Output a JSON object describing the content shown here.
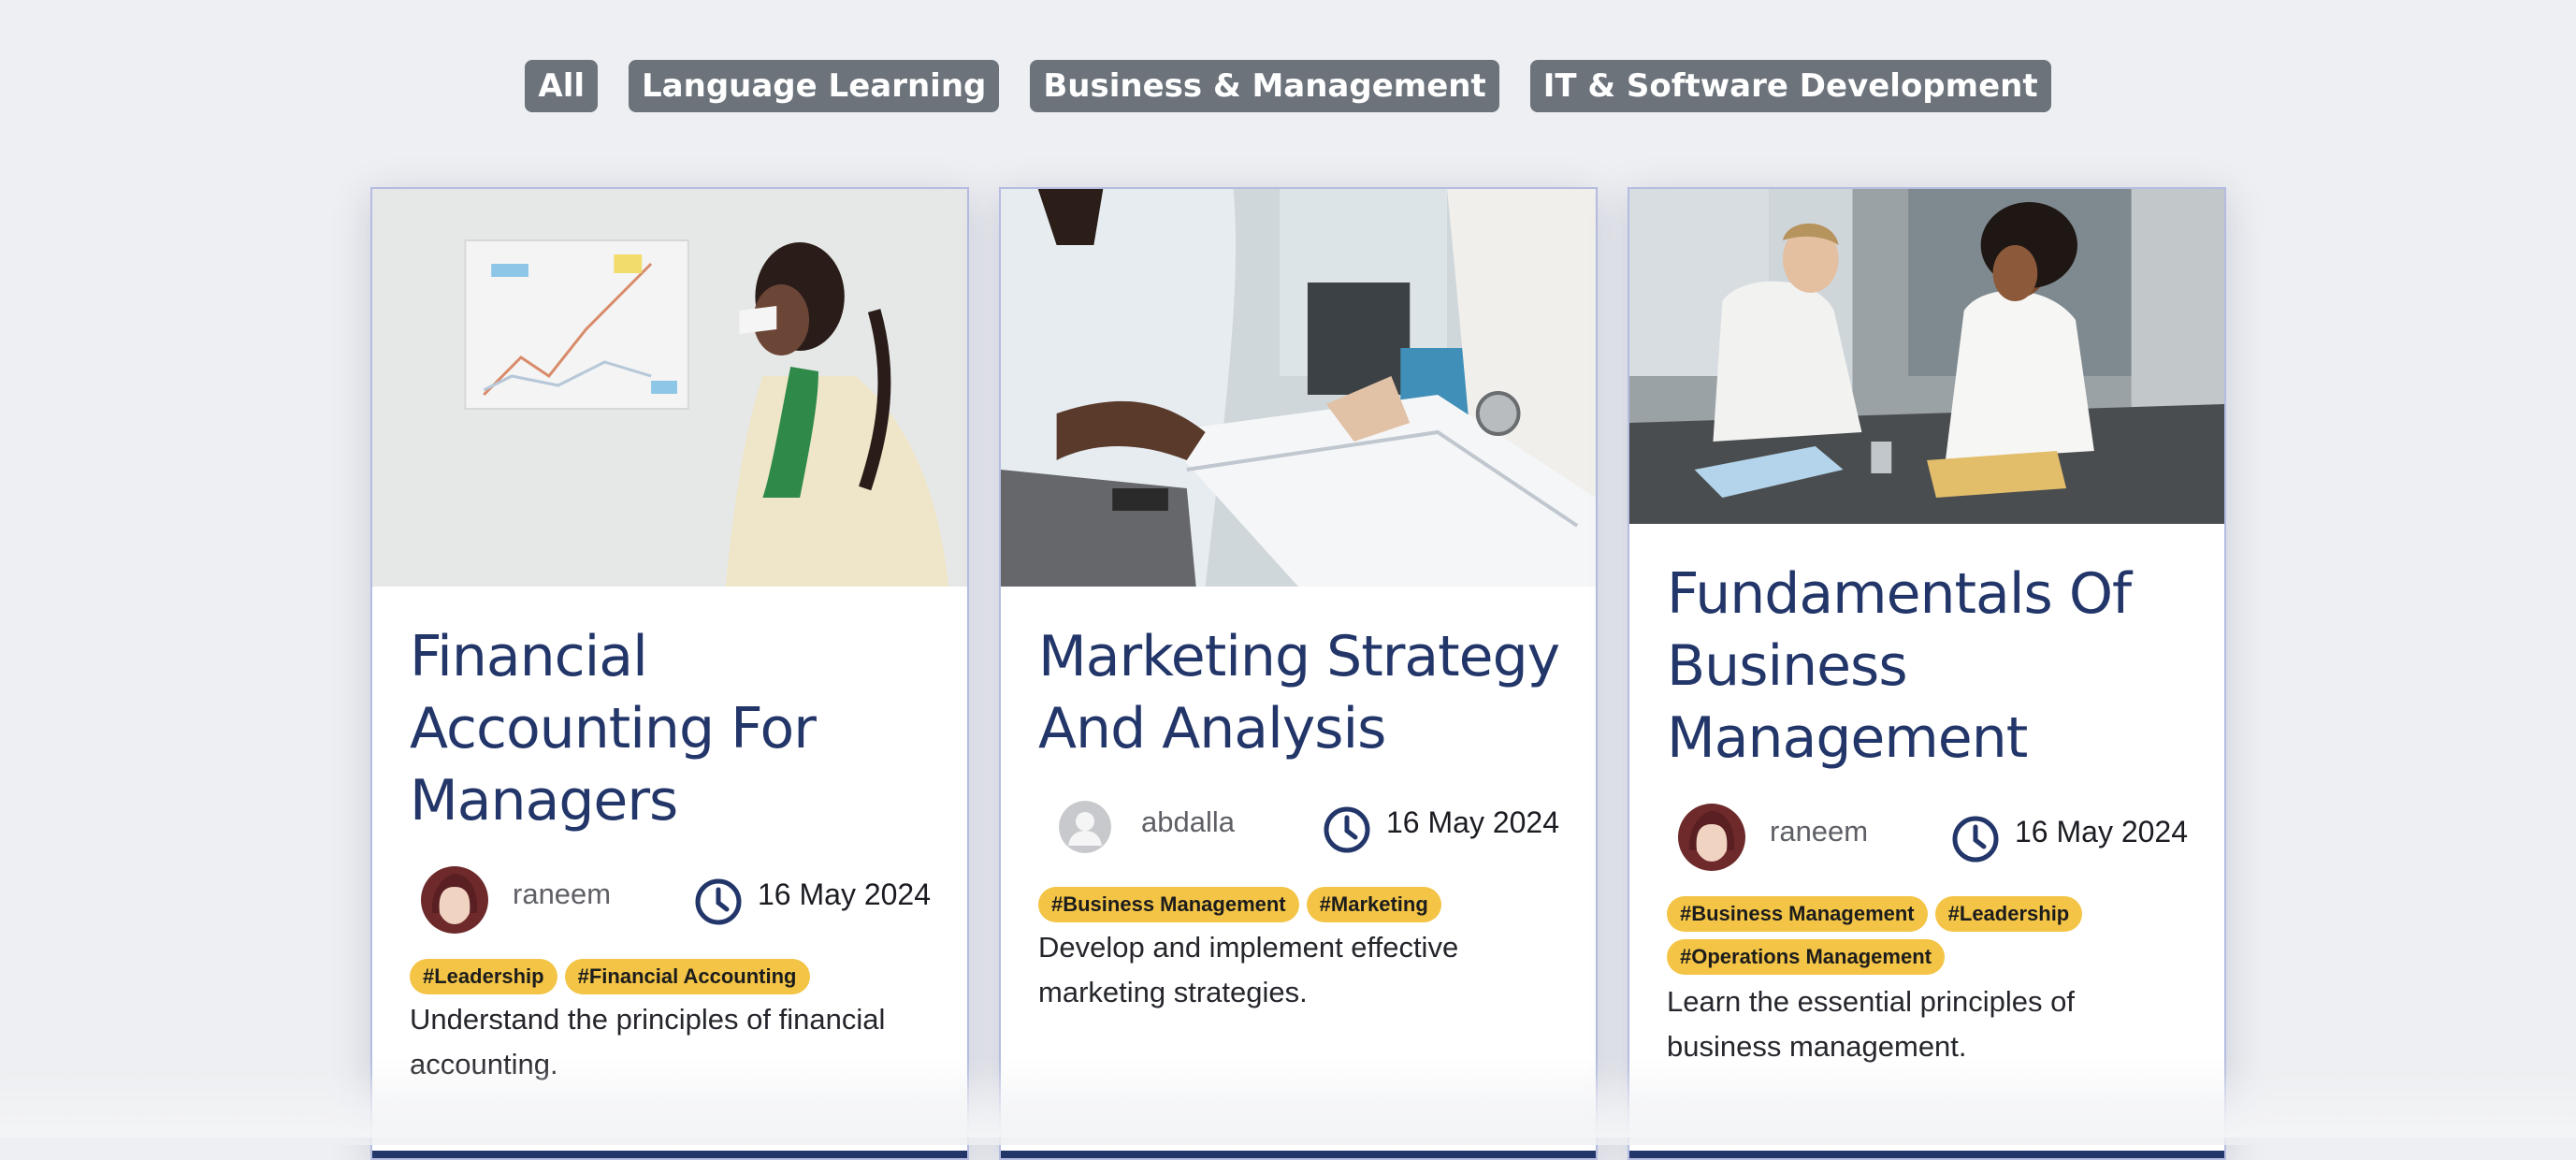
{
  "filters": [
    {
      "label": "All"
    },
    {
      "label": "Language Learning"
    },
    {
      "label": "Business & Management"
    },
    {
      "label": "IT & Software Development"
    }
  ],
  "cards": [
    {
      "title": "Financial Accounting For Managers",
      "author": "raneem",
      "date": "16 May 2024",
      "tags": [
        "#Leadership",
        "#Financial Accounting"
      ],
      "description": "Understand the principles of financial accounting."
    },
    {
      "title": "Marketing Strategy And Analysis",
      "author": "abdalla",
      "date": "16 May 2024",
      "tags": [
        "#Business Management",
        "#Marketing"
      ],
      "description": "Develop and implement effective marketing strategies."
    },
    {
      "title": "Fundamentals Of Business Management",
      "author": "raneem",
      "date": "16 May 2024",
      "tags": [
        "#Business Management",
        "#Leadership",
        "#Operations Management"
      ],
      "description": "Learn the essential principles of business management."
    }
  ],
  "colors": {
    "filter_bg": "#6c737b",
    "title": "#233669",
    "tag_bg": "#f3c446",
    "page_bg": "#eeeff2"
  }
}
